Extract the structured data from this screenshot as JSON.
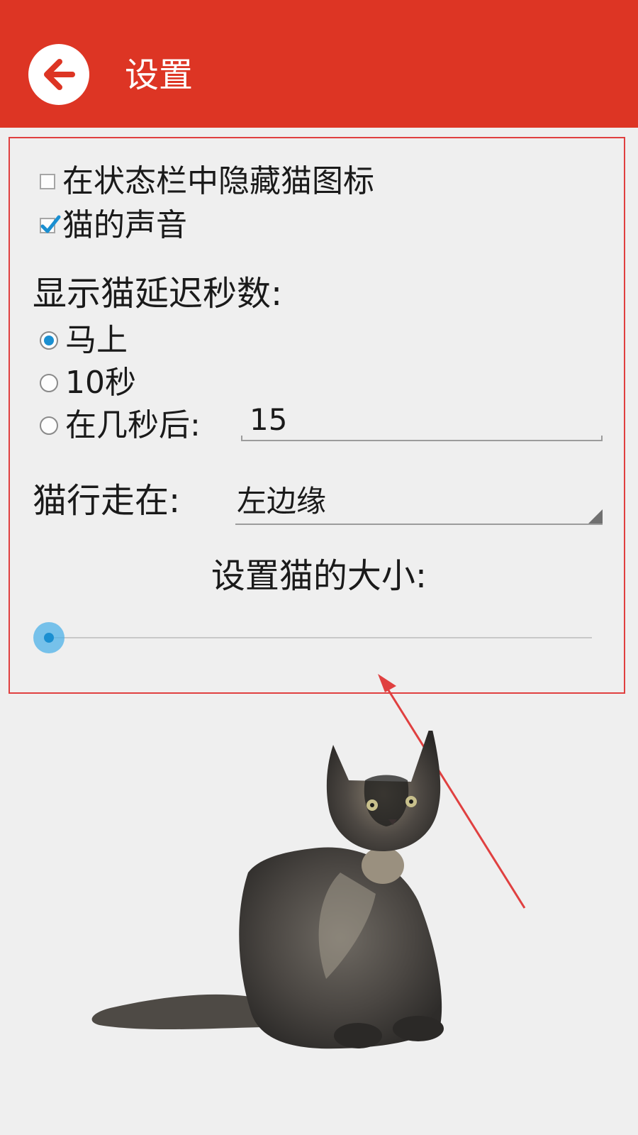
{
  "appbar": {
    "title": "设置",
    "back_icon": "arrow-left-icon",
    "color": "#dd3524"
  },
  "settings": {
    "hide_icon": {
      "label": "在状态栏中隐藏猫图标",
      "checked": false
    },
    "cat_sound": {
      "label": "猫的声音",
      "checked": true
    },
    "delay": {
      "label": "显示猫延迟秒数:",
      "options": [
        {
          "label": "马上",
          "selected": true
        },
        {
          "label": "10秒",
          "selected": false
        },
        {
          "label": "在几秒后:",
          "selected": false
        }
      ],
      "custom_seconds": "15"
    },
    "walk_edge": {
      "label": "猫行走在:",
      "value": "左边缘"
    },
    "size": {
      "label": "设置猫的大小:",
      "value": 0
    }
  },
  "colors": {
    "accent": "#1a8fd1",
    "annotation": "#e04040",
    "background": "#efefef"
  }
}
